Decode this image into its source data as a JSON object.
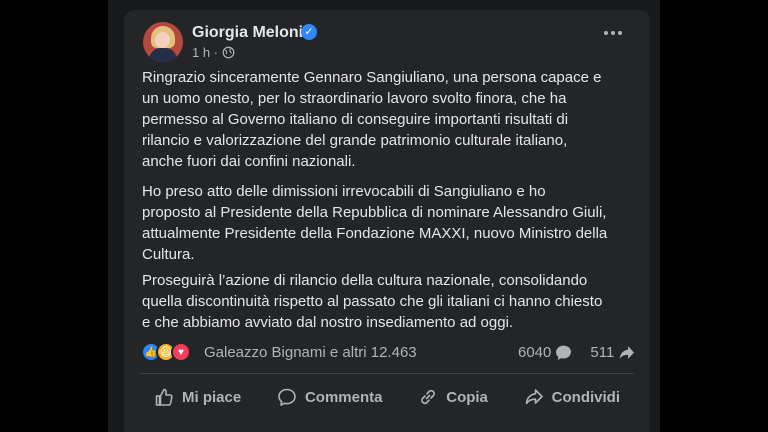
{
  "post": {
    "author": "Giorgia Meloni",
    "time": "1 h ·",
    "paragraphs": [
      "Ringrazio sinceramente Gennaro Sangiuliano, una persona capace e\nun uomo onesto, per lo straordinario lavoro svolto finora, che ha\npermesso al Governo italiano di conseguire importanti risultati di\nrilancio e valorizzazione del grande patrimonio culturale italiano,\nanche fuori dai confini nazionali.",
      "Ho preso atto delle dimissioni irrevocabili di Sangiuliano e ho\nproposto al Presidente della Repubblica di nominare Alessandro Giuli,\nattualmente Presidente della Fondazione MAXXI, nuovo Ministro della\nCultura.",
      "Proseguirà l’azione di rilancio della cultura nazionale, consolidando\nquella discontinuità rispetto al passato che gli italiani ci hanno chiesto\ne che abbiamo avviato dal nostro insediamento ad oggi."
    ]
  },
  "reactions": {
    "names": "Galeazzo Bignami e altri 12.463",
    "comments": "6040",
    "shares": "511",
    "icons": [
      "like-icon",
      "haha-icon",
      "love-icon"
    ]
  },
  "actions": {
    "like": "Mi piace",
    "comment": "Commenta",
    "copy": "Copia",
    "share": "Condividi"
  },
  "colors": {
    "card": "#242526",
    "text": "#e4e6eb",
    "muted": "#b0b3b8",
    "verified": "#2d88ff"
  }
}
